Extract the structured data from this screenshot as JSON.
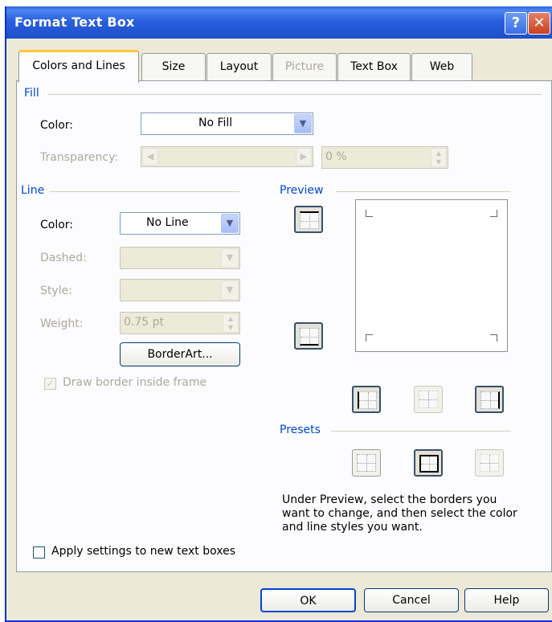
{
  "window": {
    "title": "Format Text Box",
    "help_glyph": "?",
    "close_glyph": "✕"
  },
  "tabs": [
    {
      "label": "Colors and Lines",
      "active": true
    },
    {
      "label": "Size"
    },
    {
      "label": "Layout"
    },
    {
      "label": "Picture",
      "disabled": true
    },
    {
      "label": "Text Box"
    },
    {
      "label": "Web"
    }
  ],
  "fill": {
    "group_label": "Fill",
    "color_label": "Color:",
    "color_value": "No Fill",
    "transparency_label": "Transparency:",
    "transparency_value": "0 %"
  },
  "line": {
    "group_label": "Line",
    "color_label": "Color:",
    "color_value": "No Line",
    "dashed_label": "Dashed:",
    "style_label": "Style:",
    "weight_label": "Weight:",
    "weight_value": "0.75 pt",
    "borderart_label": "BorderArt...",
    "draw_inside_label": "Draw border inside frame"
  },
  "preview": {
    "group_label": "Preview"
  },
  "presets": {
    "group_label": "Presets"
  },
  "hint_text": "Under Preview, select the borders you want to change, and then select the color and line styles you want.",
  "apply_new_label": "Apply settings to new text boxes",
  "buttons": {
    "ok": "OK",
    "cancel": "Cancel",
    "help": "Help"
  },
  "icons": {
    "dropdown": "▼",
    "spin_up": "▲",
    "spin_down": "▼",
    "scroll_left": "◀",
    "scroll_right": "▶",
    "check": "✓"
  },
  "colors": {
    "titlebar": "#2a5fde",
    "dialog_bg": "#ece9d8",
    "panel_bg": "#fcfcfe",
    "group_label": "#0046d5",
    "disabled_text": "#aca899",
    "tab_highlight": "#ffc83c"
  }
}
